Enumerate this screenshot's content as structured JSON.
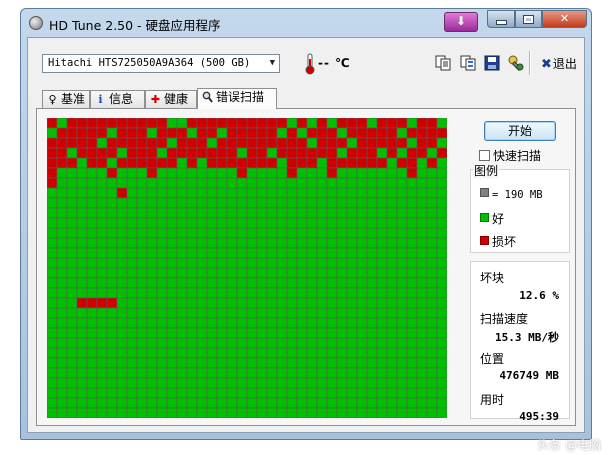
{
  "window": {
    "title": "HD Tune 2.50 - 硬盘应用程序",
    "close_glyph": "✕",
    "tray_glyph": "⬇"
  },
  "toolbar": {
    "drive": "Hitachi HTS725050A9A364 (500 GB)",
    "temperature": "-- ℃",
    "exit_label": "退出",
    "exit_glyph": "✖"
  },
  "tabs": [
    {
      "label": "基准",
      "icon": "benchmark-icon",
      "glyph": "♀"
    },
    {
      "label": "信息",
      "icon": "info-icon",
      "glyph": "i"
    },
    {
      "label": "健康",
      "icon": "health-cross-icon",
      "glyph": "✚"
    },
    {
      "label": "错误扫描",
      "icon": "magnifier-icon",
      "glyph": "🔍",
      "active": true
    }
  ],
  "scan": {
    "start_label": "开始",
    "quick_scan_label": "快速扫描",
    "quick_scan_checked": false,
    "legend_title": "图例",
    "legend": [
      {
        "label": "= 190 MB",
        "color": "#808080"
      },
      {
        "label": "好",
        "color": "#00c000"
      },
      {
        "label": "损坏",
        "color": "#d00000"
      }
    ],
    "stats": {
      "bad_blocks_label": "坏块",
      "bad_blocks_value": "12.6 %",
      "scan_speed_label": "扫描速度",
      "scan_speed_value": "15.3 MB/秒",
      "position_label": "位置",
      "position_value": "476749 MB",
      "elapsed_label": "用时",
      "elapsed_value": "495:39"
    }
  },
  "block_map": {
    "columns": 40,
    "rows": 30,
    "good_color": "#00c000",
    "bad_color": "#d00000",
    "grid_color": "#5a5a5a",
    "bad_cells": [
      [
        0,
        0
      ],
      [
        0,
        2
      ],
      [
        0,
        3
      ],
      [
        0,
        4
      ],
      [
        0,
        5
      ],
      [
        0,
        6
      ],
      [
        0,
        7
      ],
      [
        0,
        8
      ],
      [
        0,
        9
      ],
      [
        0,
        10
      ],
      [
        0,
        11
      ],
      [
        0,
        14
      ],
      [
        0,
        15
      ],
      [
        0,
        16
      ],
      [
        0,
        17
      ],
      [
        0,
        18
      ],
      [
        0,
        19
      ],
      [
        0,
        20
      ],
      [
        0,
        21
      ],
      [
        0,
        22
      ],
      [
        0,
        23
      ],
      [
        0,
        25
      ],
      [
        0,
        27
      ],
      [
        0,
        29
      ],
      [
        0,
        30
      ],
      [
        0,
        31
      ],
      [
        0,
        33
      ],
      [
        0,
        34
      ],
      [
        0,
        35
      ],
      [
        0,
        37
      ],
      [
        0,
        38
      ],
      [
        1,
        1
      ],
      [
        1,
        2
      ],
      [
        1,
        3
      ],
      [
        1,
        4
      ],
      [
        1,
        5
      ],
      [
        1,
        7
      ],
      [
        1,
        8
      ],
      [
        1,
        9
      ],
      [
        1,
        11
      ],
      [
        1,
        12
      ],
      [
        1,
        13
      ],
      [
        1,
        15
      ],
      [
        1,
        16
      ],
      [
        1,
        18
      ],
      [
        1,
        19
      ],
      [
        1,
        20
      ],
      [
        1,
        21
      ],
      [
        1,
        22
      ],
      [
        1,
        24
      ],
      [
        1,
        26
      ],
      [
        1,
        27
      ],
      [
        1,
        28
      ],
      [
        1,
        30
      ],
      [
        1,
        31
      ],
      [
        1,
        32
      ],
      [
        1,
        33
      ],
      [
        1,
        34
      ],
      [
        1,
        36
      ],
      [
        1,
        37
      ],
      [
        1,
        38
      ],
      [
        1,
        39
      ],
      [
        2,
        0
      ],
      [
        2,
        1
      ],
      [
        2,
        2
      ],
      [
        2,
        3
      ],
      [
        2,
        4
      ],
      [
        2,
        6
      ],
      [
        2,
        7
      ],
      [
        2,
        8
      ],
      [
        2,
        9
      ],
      [
        2,
        10
      ],
      [
        2,
        11
      ],
      [
        2,
        13
      ],
      [
        2,
        14
      ],
      [
        2,
        15
      ],
      [
        2,
        17
      ],
      [
        2,
        18
      ],
      [
        2,
        19
      ],
      [
        2,
        20
      ],
      [
        2,
        21
      ],
      [
        2,
        22
      ],
      [
        2,
        23
      ],
      [
        2,
        24
      ],
      [
        2,
        25
      ],
      [
        2,
        27
      ],
      [
        2,
        28
      ],
      [
        2,
        29
      ],
      [
        2,
        31
      ],
      [
        2,
        32
      ],
      [
        2,
        33
      ],
      [
        2,
        34
      ],
      [
        2,
        35
      ],
      [
        2,
        37
      ],
      [
        2,
        38
      ],
      [
        3,
        0
      ],
      [
        3,
        1
      ],
      [
        3,
        3
      ],
      [
        3,
        4
      ],
      [
        3,
        5
      ],
      [
        3,
        6
      ],
      [
        3,
        8
      ],
      [
        3,
        9
      ],
      [
        3,
        10
      ],
      [
        3,
        12
      ],
      [
        3,
        13
      ],
      [
        3,
        14
      ],
      [
        3,
        15
      ],
      [
        3,
        16
      ],
      [
        3,
        17
      ],
      [
        3,
        18
      ],
      [
        3,
        20
      ],
      [
        3,
        21
      ],
      [
        3,
        23
      ],
      [
        3,
        24
      ],
      [
        3,
        25
      ],
      [
        3,
        26
      ],
      [
        3,
        27
      ],
      [
        3,
        28
      ],
      [
        3,
        30
      ],
      [
        3,
        31
      ],
      [
        3,
        32
      ],
      [
        3,
        34
      ],
      [
        3,
        36
      ],
      [
        3,
        37
      ],
      [
        3,
        39
      ],
      [
        4,
        0
      ],
      [
        4,
        1
      ],
      [
        4,
        2
      ],
      [
        4,
        4
      ],
      [
        4,
        5
      ],
      [
        4,
        7
      ],
      [
        4,
        8
      ],
      [
        4,
        9
      ],
      [
        4,
        10
      ],
      [
        4,
        11
      ],
      [
        4,
        12
      ],
      [
        4,
        14
      ],
      [
        4,
        16
      ],
      [
        4,
        17
      ],
      [
        4,
        18
      ],
      [
        4,
        19
      ],
      [
        4,
        20
      ],
      [
        4,
        21
      ],
      [
        4,
        22
      ],
      [
        4,
        24
      ],
      [
        4,
        25
      ],
      [
        4,
        26
      ],
      [
        4,
        28
      ],
      [
        4,
        29
      ],
      [
        4,
        30
      ],
      [
        4,
        31
      ],
      [
        4,
        32
      ],
      [
        4,
        33
      ],
      [
        4,
        35
      ],
      [
        4,
        36
      ],
      [
        4,
        38
      ],
      [
        5,
        0
      ],
      [
        5,
        6
      ],
      [
        5,
        10
      ],
      [
        5,
        19
      ],
      [
        5,
        24
      ],
      [
        5,
        28
      ],
      [
        5,
        36
      ],
      [
        6,
        0
      ],
      [
        7,
        7
      ],
      [
        18,
        3
      ],
      [
        18,
        4
      ],
      [
        18,
        5
      ],
      [
        18,
        6
      ]
    ]
  },
  "watermark": "头条 @电脑"
}
